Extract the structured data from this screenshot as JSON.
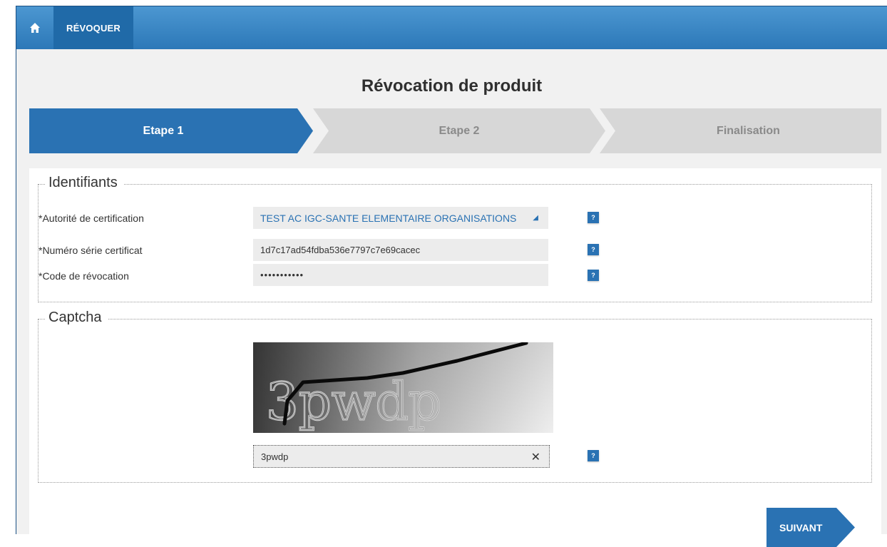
{
  "topbar": {
    "home_icon": "home-icon",
    "breadcrumb": "RÉVOQUER"
  },
  "page_title": "Révocation de produit",
  "steps": [
    {
      "label": "Etape 1",
      "active": true
    },
    {
      "label": "Etape 2",
      "active": false
    },
    {
      "label": "Finalisation",
      "active": false
    }
  ],
  "identifiants": {
    "legend": "Identifiants",
    "authority_label": "*Autorité de certification",
    "authority_value": "TEST AC IGC-SANTE ELEMENTAIRE ORGANISATIONS",
    "serial_label": "*Numéro série certificat",
    "serial_value": "1d7c17ad54fdba536e7797c7e69cacec",
    "code_label": "*Code de révocation",
    "code_value": "•••••••••••",
    "help_label": "?"
  },
  "captcha": {
    "legend": "Captcha",
    "image_text": "3pwdp",
    "input_value": "3pwdp",
    "clear_glyph": "✕",
    "help_label": "?"
  },
  "next_label": "SUIVANT",
  "colors": {
    "primary": "#2a72b3",
    "topbar_light": "#4c97d1",
    "topbar_dark": "#2c78b8",
    "inactive_step": "#d7d7d7",
    "background": "#f1f1f1"
  }
}
